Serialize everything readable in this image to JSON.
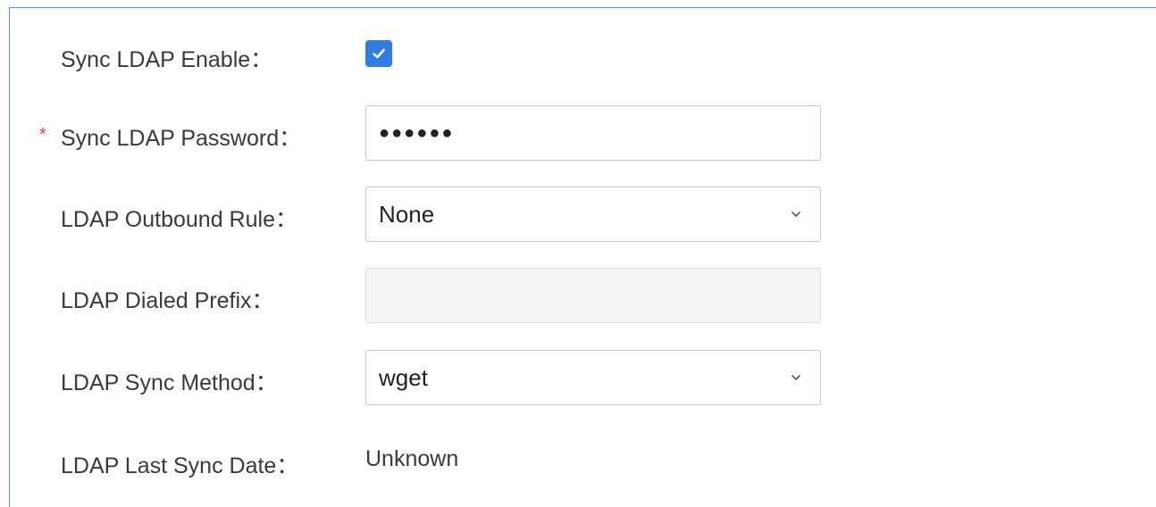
{
  "form": {
    "sync_enable": {
      "label": "Sync LDAP Enable：",
      "checked": true
    },
    "sync_password": {
      "required_mark": "*",
      "label": "Sync LDAP Password：",
      "value": "●●●●●●"
    },
    "outbound_rule": {
      "label": "LDAP Outbound Rule：",
      "selected": "None"
    },
    "dialed_prefix": {
      "label": "LDAP Dialed Prefix：",
      "value": ""
    },
    "sync_method": {
      "label": "LDAP Sync Method：",
      "selected": "wget"
    },
    "last_sync_date": {
      "label": "LDAP Last Sync Date：",
      "value": "Unknown"
    }
  },
  "colors": {
    "accent": "#2f7ee6",
    "required": "#e2413a",
    "panel_border": "#5b8fd6"
  },
  "icons": {
    "checkbox": "check-icon",
    "select": "chevron-down-icon"
  }
}
